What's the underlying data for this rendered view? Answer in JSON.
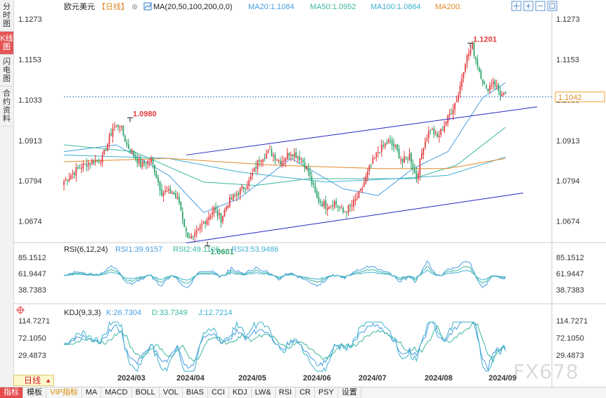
{
  "sidebar": {
    "tabs": [
      {
        "label": "分时图",
        "active": false
      },
      {
        "label": "K线图",
        "active": true
      },
      {
        "label": "闪电图",
        "active": false
      },
      {
        "label": "合约资料",
        "active": false
      }
    ]
  },
  "header": {
    "symbol": "欧元美元",
    "period": "【日线】",
    "ma_label": "MA(20,50,100,200,0,0)",
    "ma20": "MA20:1.1084",
    "ma50": "MA50:1.0952",
    "ma100": "MA100:1.0864",
    "ma200": "MA200:"
  },
  "colors": {
    "up": "#e4393c",
    "down": "#2aa26a",
    "ma20": "#4a9ee0",
    "ma50": "#3cb8a0",
    "ma100": "#40b0d0",
    "ma200": "#e08a2a",
    "channel": "#2626c8",
    "text_blue": "#2a74c8"
  },
  "chart_data": [
    {
      "type": "candlestick",
      "title": "欧元美元 日线",
      "x_ticks": [
        "2024/03",
        "2024/04",
        "2024/05",
        "2024/06",
        "2024/07",
        "2024/08",
        "2024/09"
      ],
      "y_ticks": [
        1.1273,
        1.1153,
        1.1033,
        1.0913,
        1.0794,
        1.0674
      ],
      "ylim": [
        1.0617,
        1.1283
      ],
      "last_price": 1.1042,
      "annotations": [
        {
          "label": "1.0980",
          "value": 1.098,
          "kind": "high"
        },
        {
          "label": "1.0601",
          "value": 1.0601,
          "kind": "low"
        },
        {
          "label": "1.1201",
          "value": 1.1201,
          "kind": "high"
        }
      ],
      "anchors": [
        [
          0,
          1.0792
        ],
        [
          8,
          1.083
        ],
        [
          15,
          1.085
        ],
        [
          22,
          1.086
        ],
        [
          28,
          1.095
        ],
        [
          32,
          1.096
        ],
        [
          36,
          1.09
        ],
        [
          44,
          1.084
        ],
        [
          50,
          1.0855
        ],
        [
          56,
          1.076
        ],
        [
          62,
          1.076
        ],
        [
          66,
          1.073
        ],
        [
          70,
          1.064
        ],
        [
          74,
          1.062
        ],
        [
          80,
          1.067
        ],
        [
          86,
          1.071
        ],
        [
          90,
          1.068
        ],
        [
          94,
          1.073
        ],
        [
          100,
          1.076
        ],
        [
          106,
          1.079
        ],
        [
          112,
          1.086
        ],
        [
          118,
          1.088
        ],
        [
          124,
          1.085
        ],
        [
          130,
          1.088
        ],
        [
          136,
          1.086
        ],
        [
          140,
          1.082
        ],
        [
          145,
          1.074
        ],
        [
          150,
          1.072
        ],
        [
          155,
          1.073
        ],
        [
          160,
          1.07
        ],
        [
          165,
          1.072
        ],
        [
          170,
          1.076
        ],
        [
          175,
          1.083
        ],
        [
          180,
          1.088
        ],
        [
          186,
          1.091
        ],
        [
          190,
          1.089
        ],
        [
          194,
          1.085
        ],
        [
          198,
          1.087
        ],
        [
          202,
          1.08
        ],
        [
          206,
          1.09
        ],
        [
          210,
          1.095
        ],
        [
          214,
          1.092
        ],
        [
          218,
          1.096
        ],
        [
          222,
          1.1
        ],
        [
          226,
          1.105
        ],
        [
          230,
          1.115
        ],
        [
          234,
          1.119
        ],
        [
          238,
          1.112
        ],
        [
          242,
          1.106
        ],
        [
          246,
          1.109
        ],
        [
          250,
          1.105
        ],
        [
          253,
          1.1042
        ]
      ],
      "ma_anchors": {
        "ma20": [
          [
            0,
            1.088
          ],
          [
            30,
            1.09
          ],
          [
            60,
            1.081
          ],
          [
            80,
            1.07
          ],
          [
            100,
            1.074
          ],
          [
            130,
            1.086
          ],
          [
            160,
            1.077
          ],
          [
            180,
            1.075
          ],
          [
            200,
            1.083
          ],
          [
            220,
            1.088
          ],
          [
            240,
            1.104
          ],
          [
            253,
            1.1084
          ]
        ],
        "ma50": [
          [
            0,
            1.09
          ],
          [
            40,
            1.088
          ],
          [
            80,
            1.079
          ],
          [
            110,
            1.078
          ],
          [
            140,
            1.08
          ],
          [
            170,
            1.08
          ],
          [
            200,
            1.08
          ],
          [
            225,
            1.084
          ],
          [
            240,
            1.09
          ],
          [
            253,
            1.0952
          ]
        ],
        "ma100": [
          [
            0,
            1.087
          ],
          [
            60,
            1.086
          ],
          [
            100,
            1.082
          ],
          [
            150,
            1.079
          ],
          [
            190,
            1.08
          ],
          [
            220,
            1.081
          ],
          [
            253,
            1.0864
          ]
        ],
        "ma200": [
          [
            0,
            1.085
          ],
          [
            60,
            1.086
          ],
          [
            120,
            1.084
          ],
          [
            180,
            1.083
          ],
          [
            220,
            1.083
          ],
          [
            253,
            1.086
          ]
        ]
      },
      "channel": {
        "upper": [
          [
            70,
            1.087
          ],
          [
            253,
            1.1
          ]
        ],
        "lower": [
          [
            70,
            1.061
          ],
          [
            245,
            1.0745
          ]
        ]
      }
    },
    {
      "type": "line",
      "title": "RSI(6,12,24)",
      "series": [
        {
          "name": "RSI1",
          "value": "RSI1:39.9157"
        },
        {
          "name": "RSI2",
          "value": "RSI2:49.1106"
        },
        {
          "name": "RSI3",
          "value": "RSI3:53.9486"
        }
      ],
      "y_ticks": [
        85.1512,
        61.9447,
        38.7383
      ]
    },
    {
      "type": "line",
      "title": "KDJ(9,3,3)",
      "series": [
        {
          "name": "K",
          "value": "K:26.7304"
        },
        {
          "name": "D",
          "value": "D:33.7349"
        },
        {
          "name": "J",
          "value": "J:12.7214"
        }
      ],
      "y_ticks": [
        114.7271,
        72.105,
        29.4873
      ]
    }
  ],
  "toolbar": {
    "period_button": "日线",
    "items": [
      "指标",
      "模板",
      "VIP指标",
      "MA",
      "MACD",
      "BOLL",
      "VOL",
      "BIAS",
      "CCI",
      "KDJ",
      "LW&",
      "RSI",
      "CR",
      "PSY",
      "设置"
    ]
  },
  "watermark": "FX678"
}
